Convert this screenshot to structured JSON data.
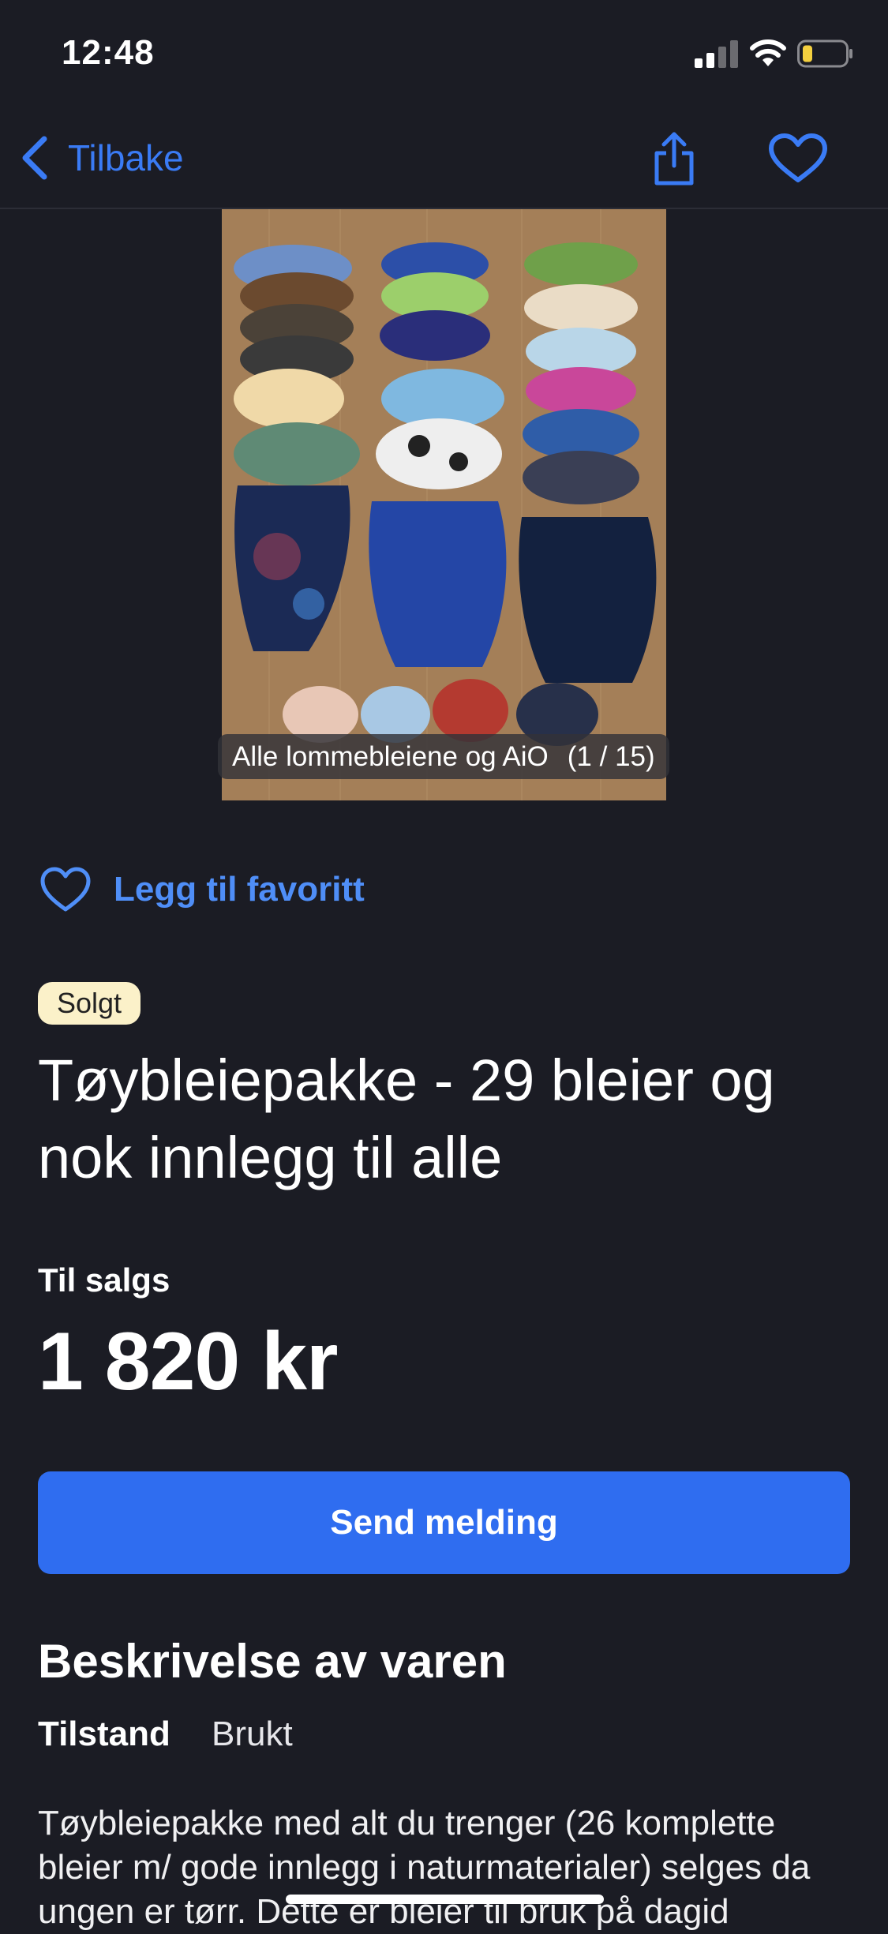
{
  "status_bar": {
    "time": "12:48",
    "battery_color": "#f4d03f"
  },
  "nav": {
    "back_label": "Tilbake",
    "icon_color": "#3a7bf5"
  },
  "image": {
    "caption": "Alle lommebleiene og AiO",
    "counter": "(1 / 15)"
  },
  "favorite": {
    "label": "Legg til favoritt"
  },
  "listing": {
    "status_badge": "Solgt",
    "title": "Tøybleiepakke - 29 bleier og nok innlegg til alle",
    "sale_type": "Til salgs",
    "price": "1 820 kr"
  },
  "actions": {
    "send_message": "Send melding"
  },
  "description": {
    "heading": "Beskrivelse av varen",
    "condition_label": "Tilstand",
    "condition_value": "Brukt",
    "text": "Tøybleiepakke med alt du trenger (26 komplette bleier m/ gode innlegg i naturmaterialer) selges da ungen er tørr. Dette er bleier til bruk på dagid"
  },
  "colors": {
    "background": "#1b1c24",
    "accent": "#2f6df0",
    "link": "#4f8ef7",
    "badge": "#fbf1c9"
  }
}
